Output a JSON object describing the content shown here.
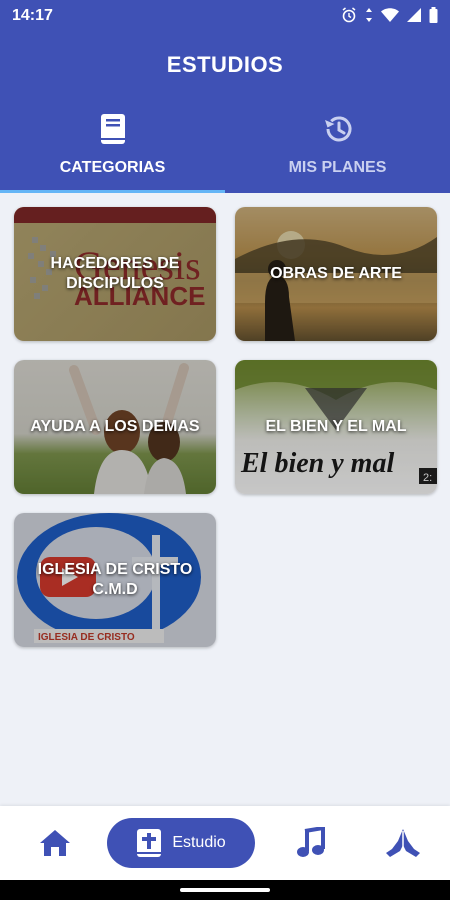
{
  "status": {
    "time": "14:17"
  },
  "header": {
    "title": "ESTUDIOS"
  },
  "tabs": [
    {
      "label": "CATEGORIAS",
      "icon": "book-icon",
      "active": true
    },
    {
      "label": "MIS PLANES",
      "icon": "history-icon",
      "active": false
    }
  ],
  "categories": [
    {
      "label": "HACEDORES DE DISCIPULOS"
    },
    {
      "label": "OBRAS DE ARTE"
    },
    {
      "label": "AYUDA A LOS DEMAS"
    },
    {
      "label": "EL BIEN Y EL MAL"
    },
    {
      "label": "IGLESIA DE CRISTO C.M.D"
    }
  ],
  "thumbnail_text": {
    "genesis_top": "Genesis",
    "genesis_bottom": "ALLIANCE",
    "bien_mal": "El bien y mal",
    "iglesia_caption": "IGLESIA DE CRISTO",
    "video_time": "2:"
  },
  "bottom_nav": {
    "items": [
      {
        "icon": "home-icon"
      },
      {
        "icon": "bible-cross-icon",
        "label": "Estudio",
        "active": true
      },
      {
        "icon": "music-note-icon"
      },
      {
        "icon": "praying-hands-icon"
      }
    ]
  },
  "colors": {
    "primary": "#3f51b5",
    "tab_indicator": "#64b5f6",
    "background": "#eef1f7"
  }
}
